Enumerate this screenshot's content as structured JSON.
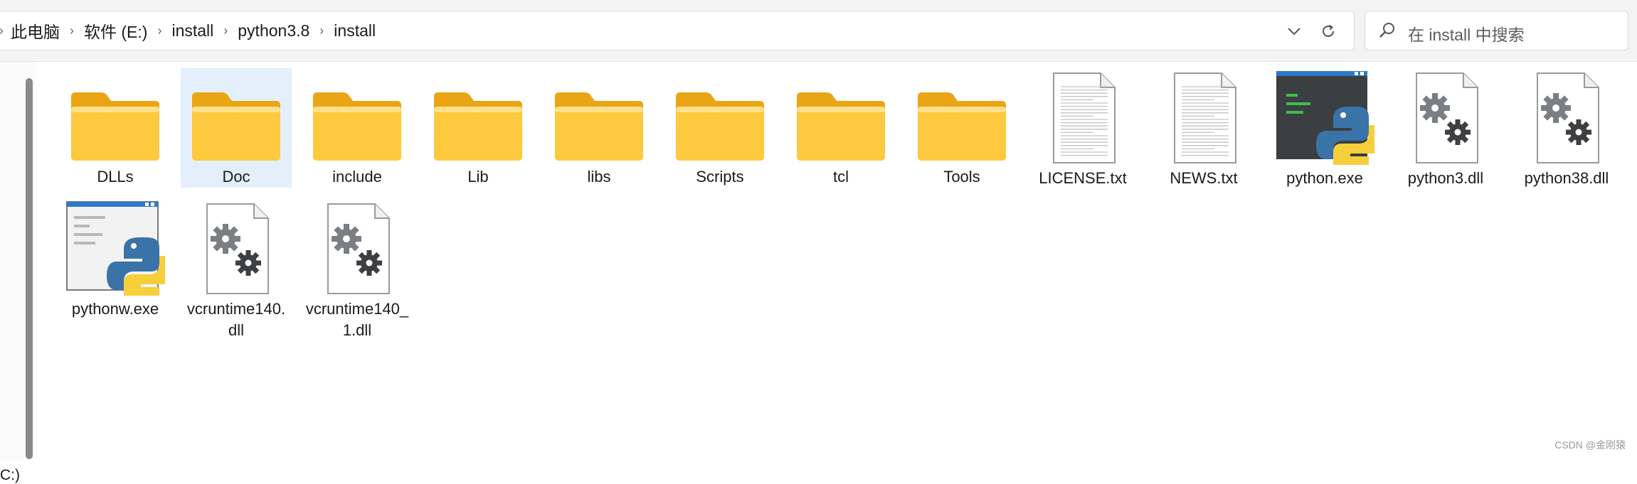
{
  "breadcrumb": [
    "此电脑",
    "软件 (E:)",
    "install",
    "python3.8",
    "install"
  ],
  "search": {
    "placeholder": "在 install 中搜索"
  },
  "sidebar": {
    "drive_fragment": "C:)"
  },
  "files": [
    {
      "name": "DLLs",
      "type": "folder",
      "selected": false
    },
    {
      "name": "Doc",
      "type": "folder",
      "selected": true
    },
    {
      "name": "include",
      "type": "folder",
      "selected": false
    },
    {
      "name": "Lib",
      "type": "folder",
      "selected": false
    },
    {
      "name": "libs",
      "type": "folder",
      "selected": false
    },
    {
      "name": "Scripts",
      "type": "folder",
      "selected": false
    },
    {
      "name": "tcl",
      "type": "folder",
      "selected": false
    },
    {
      "name": "Tools",
      "type": "folder",
      "selected": false
    },
    {
      "name": "LICENSE.txt",
      "type": "text",
      "selected": false
    },
    {
      "name": "NEWS.txt",
      "type": "text",
      "selected": false
    },
    {
      "name": "python.exe",
      "type": "python-exe",
      "selected": false
    },
    {
      "name": "python3.dll",
      "type": "dll",
      "selected": false
    },
    {
      "name": "python38.dll",
      "type": "dll",
      "selected": false
    },
    {
      "name": "pythonw.exe",
      "type": "pythonw-exe",
      "selected": false
    },
    {
      "name": "vcruntime140.dll",
      "type": "dll",
      "selected": false
    },
    {
      "name": "vcruntime140_1.dll",
      "type": "dll",
      "selected": false
    }
  ],
  "watermark": "CSDN @金刚猿",
  "colors": {
    "folder": "#fcc93f",
    "selection": "#e3effb",
    "python_blue": "#3a73a7",
    "python_yellow": "#f6cf3a"
  }
}
